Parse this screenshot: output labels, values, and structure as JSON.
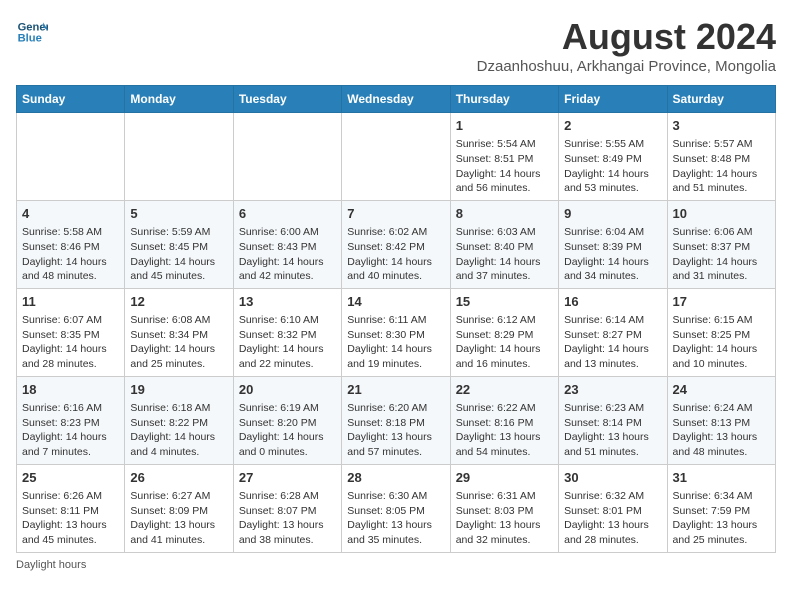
{
  "header": {
    "logo_line1": "General",
    "logo_line2": "Blue",
    "month_title": "August 2024",
    "subtitle": "Dzaanhoshuu, Arkhangai Province, Mongolia"
  },
  "days_of_week": [
    "Sunday",
    "Monday",
    "Tuesday",
    "Wednesday",
    "Thursday",
    "Friday",
    "Saturday"
  ],
  "footer": {
    "daylight_hours": "Daylight hours"
  },
  "weeks": [
    [
      {
        "day": "",
        "info": ""
      },
      {
        "day": "",
        "info": ""
      },
      {
        "day": "",
        "info": ""
      },
      {
        "day": "",
        "info": ""
      },
      {
        "day": "1",
        "info": "Sunrise: 5:54 AM\nSunset: 8:51 PM\nDaylight: 14 hours\nand 56 minutes."
      },
      {
        "day": "2",
        "info": "Sunrise: 5:55 AM\nSunset: 8:49 PM\nDaylight: 14 hours\nand 53 minutes."
      },
      {
        "day": "3",
        "info": "Sunrise: 5:57 AM\nSunset: 8:48 PM\nDaylight: 14 hours\nand 51 minutes."
      }
    ],
    [
      {
        "day": "4",
        "info": "Sunrise: 5:58 AM\nSunset: 8:46 PM\nDaylight: 14 hours\nand 48 minutes."
      },
      {
        "day": "5",
        "info": "Sunrise: 5:59 AM\nSunset: 8:45 PM\nDaylight: 14 hours\nand 45 minutes."
      },
      {
        "day": "6",
        "info": "Sunrise: 6:00 AM\nSunset: 8:43 PM\nDaylight: 14 hours\nand 42 minutes."
      },
      {
        "day": "7",
        "info": "Sunrise: 6:02 AM\nSunset: 8:42 PM\nDaylight: 14 hours\nand 40 minutes."
      },
      {
        "day": "8",
        "info": "Sunrise: 6:03 AM\nSunset: 8:40 PM\nDaylight: 14 hours\nand 37 minutes."
      },
      {
        "day": "9",
        "info": "Sunrise: 6:04 AM\nSunset: 8:39 PM\nDaylight: 14 hours\nand 34 minutes."
      },
      {
        "day": "10",
        "info": "Sunrise: 6:06 AM\nSunset: 8:37 PM\nDaylight: 14 hours\nand 31 minutes."
      }
    ],
    [
      {
        "day": "11",
        "info": "Sunrise: 6:07 AM\nSunset: 8:35 PM\nDaylight: 14 hours\nand 28 minutes."
      },
      {
        "day": "12",
        "info": "Sunrise: 6:08 AM\nSunset: 8:34 PM\nDaylight: 14 hours\nand 25 minutes."
      },
      {
        "day": "13",
        "info": "Sunrise: 6:10 AM\nSunset: 8:32 PM\nDaylight: 14 hours\nand 22 minutes."
      },
      {
        "day": "14",
        "info": "Sunrise: 6:11 AM\nSunset: 8:30 PM\nDaylight: 14 hours\nand 19 minutes."
      },
      {
        "day": "15",
        "info": "Sunrise: 6:12 AM\nSunset: 8:29 PM\nDaylight: 14 hours\nand 16 minutes."
      },
      {
        "day": "16",
        "info": "Sunrise: 6:14 AM\nSunset: 8:27 PM\nDaylight: 14 hours\nand 13 minutes."
      },
      {
        "day": "17",
        "info": "Sunrise: 6:15 AM\nSunset: 8:25 PM\nDaylight: 14 hours\nand 10 minutes."
      }
    ],
    [
      {
        "day": "18",
        "info": "Sunrise: 6:16 AM\nSunset: 8:23 PM\nDaylight: 14 hours\nand 7 minutes."
      },
      {
        "day": "19",
        "info": "Sunrise: 6:18 AM\nSunset: 8:22 PM\nDaylight: 14 hours\nand 4 minutes."
      },
      {
        "day": "20",
        "info": "Sunrise: 6:19 AM\nSunset: 8:20 PM\nDaylight: 14 hours\nand 0 minutes."
      },
      {
        "day": "21",
        "info": "Sunrise: 6:20 AM\nSunset: 8:18 PM\nDaylight: 13 hours\nand 57 minutes."
      },
      {
        "day": "22",
        "info": "Sunrise: 6:22 AM\nSunset: 8:16 PM\nDaylight: 13 hours\nand 54 minutes."
      },
      {
        "day": "23",
        "info": "Sunrise: 6:23 AM\nSunset: 8:14 PM\nDaylight: 13 hours\nand 51 minutes."
      },
      {
        "day": "24",
        "info": "Sunrise: 6:24 AM\nSunset: 8:13 PM\nDaylight: 13 hours\nand 48 minutes."
      }
    ],
    [
      {
        "day": "25",
        "info": "Sunrise: 6:26 AM\nSunset: 8:11 PM\nDaylight: 13 hours\nand 45 minutes."
      },
      {
        "day": "26",
        "info": "Sunrise: 6:27 AM\nSunset: 8:09 PM\nDaylight: 13 hours\nand 41 minutes."
      },
      {
        "day": "27",
        "info": "Sunrise: 6:28 AM\nSunset: 8:07 PM\nDaylight: 13 hours\nand 38 minutes."
      },
      {
        "day": "28",
        "info": "Sunrise: 6:30 AM\nSunset: 8:05 PM\nDaylight: 13 hours\nand 35 minutes."
      },
      {
        "day": "29",
        "info": "Sunrise: 6:31 AM\nSunset: 8:03 PM\nDaylight: 13 hours\nand 32 minutes."
      },
      {
        "day": "30",
        "info": "Sunrise: 6:32 AM\nSunset: 8:01 PM\nDaylight: 13 hours\nand 28 minutes."
      },
      {
        "day": "31",
        "info": "Sunrise: 6:34 AM\nSunset: 7:59 PM\nDaylight: 13 hours\nand 25 minutes."
      }
    ]
  ]
}
